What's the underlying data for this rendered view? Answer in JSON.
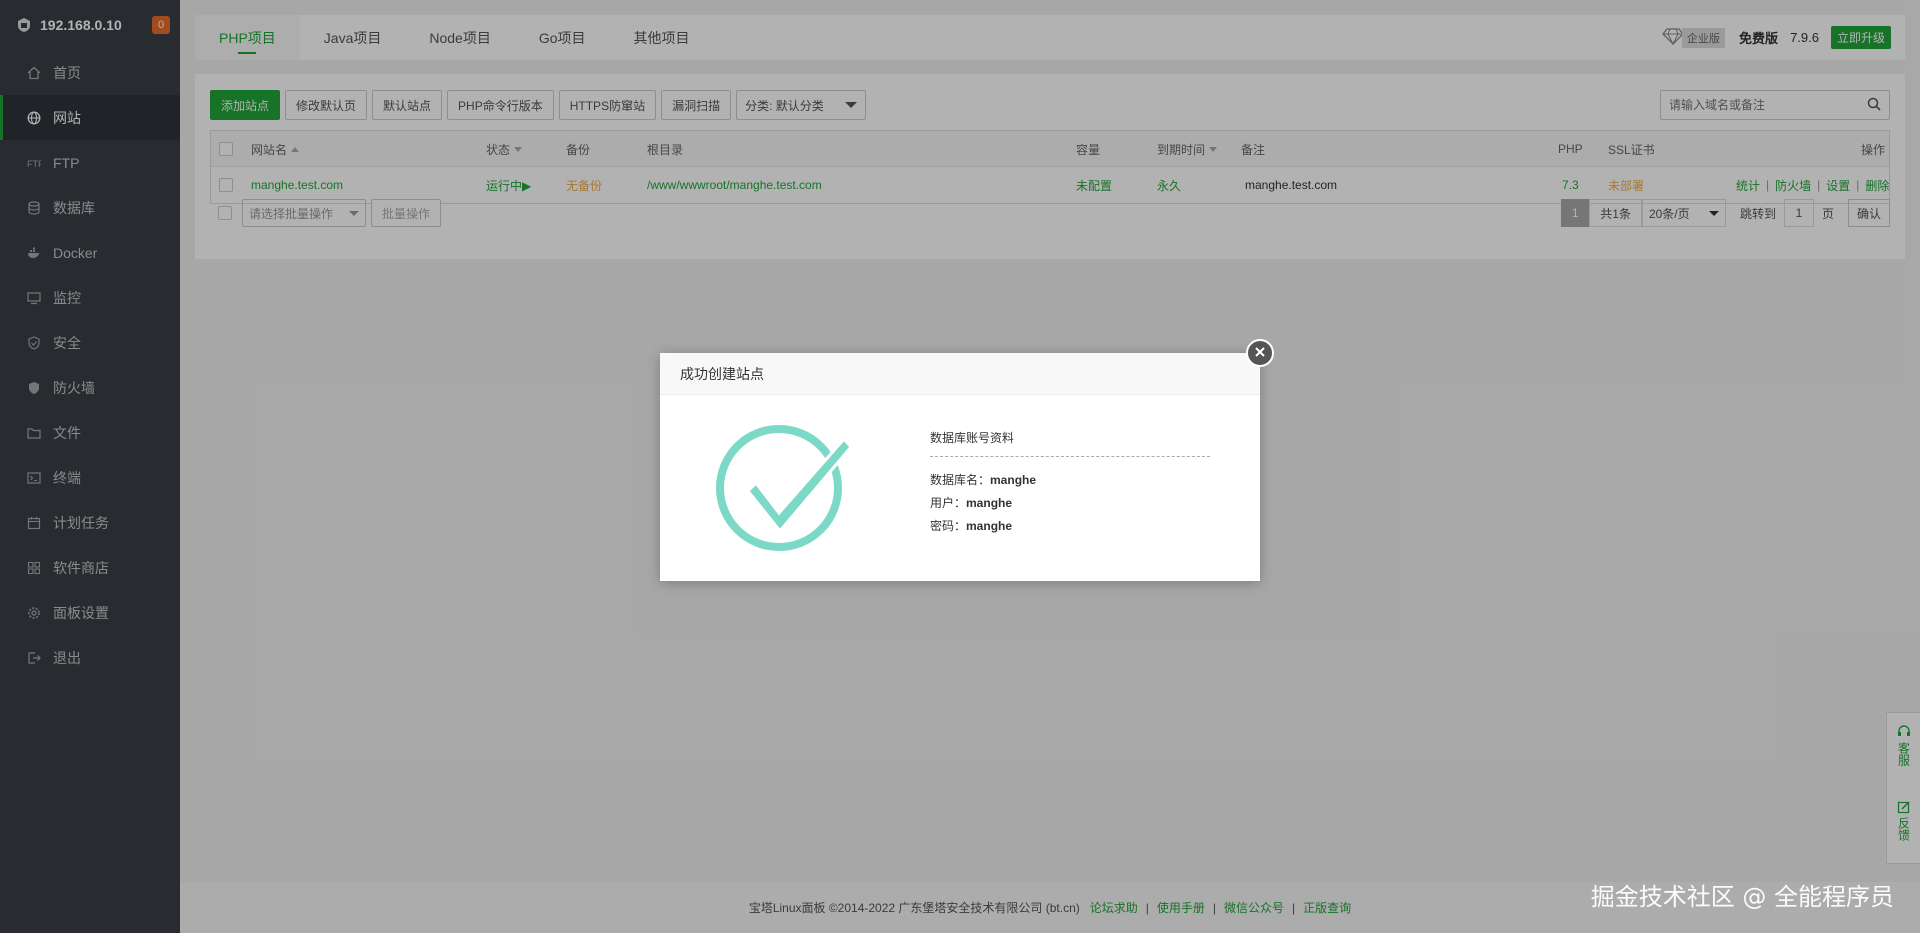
{
  "sidebar": {
    "server_ip": "192.168.0.10",
    "notification_count": "0",
    "items": [
      {
        "label": "首页",
        "icon": "home-icon"
      },
      {
        "label": "网站",
        "icon": "globe-icon",
        "active": true
      },
      {
        "label": "FTP",
        "icon": "ftp-icon"
      },
      {
        "label": "数据库",
        "icon": "database-icon"
      },
      {
        "label": "Docker",
        "icon": "docker-icon"
      },
      {
        "label": "监控",
        "icon": "monitor-icon"
      },
      {
        "label": "安全",
        "icon": "shield-check-icon"
      },
      {
        "label": "防火墙",
        "icon": "shield-icon"
      },
      {
        "label": "文件",
        "icon": "folder-icon"
      },
      {
        "label": "终端",
        "icon": "terminal-icon"
      },
      {
        "label": "计划任务",
        "icon": "calendar-icon"
      },
      {
        "label": "软件商店",
        "icon": "apps-icon"
      },
      {
        "label": "面板设置",
        "icon": "gear-icon"
      },
      {
        "label": "退出",
        "icon": "logout-icon"
      }
    ]
  },
  "topbar": {
    "tabs": [
      "PHP项目",
      "Java项目",
      "Node项目",
      "Go项目",
      "其他项目"
    ],
    "enterprise_label": "企业版",
    "free_label": "免费版",
    "version": "7.9.6",
    "upgrade_label": "立即升级"
  },
  "toolbar": {
    "add_site": "添加站点",
    "edit_default_page": "修改默认页",
    "default_site": "默认站点",
    "php_cli_version": "PHP命令行版本",
    "https_guard": "HTTPS防窜站",
    "vuln_scan": "漏洞扫描",
    "category_select": "分类: 默认分类",
    "search_placeholder": "请输入域名或备注"
  },
  "table": {
    "headers": {
      "name": "网站名",
      "status": "状态",
      "backup": "备份",
      "root": "根目录",
      "quota": "容量",
      "expire": "到期时间",
      "remark": "备注",
      "php": "PHP",
      "ssl": "SSL证书",
      "action": "操作"
    },
    "rows": [
      {
        "name": "manghe.test.com",
        "status": "运行中▶",
        "backup": "无备份",
        "root": "/www/wwwroot/manghe.test.com",
        "quota": "未配置",
        "expire": "永久",
        "remark": "manghe.test.com",
        "php": "7.3",
        "ssl": "未部署",
        "actions": [
          "统计",
          "防火墙",
          "设置",
          "删除"
        ]
      }
    ]
  },
  "bottom": {
    "bulk_placeholder": "请选择批量操作",
    "bulk_button": "批量操作",
    "page_current": "1",
    "page_total": "共1条",
    "page_size": "20条/页",
    "jump_label": "跳转到",
    "jump_value": "1",
    "page_unit": "页",
    "confirm": "确认"
  },
  "footer": {
    "copyright": "宝塔Linux面板 ©2014-2022 广东堡塔安全技术有限公司 (bt.cn)",
    "links": [
      "论坛求助",
      "使用手册",
      "微信公众号",
      "正版查询"
    ]
  },
  "float_panel": {
    "service": "客服",
    "feedback": "反馈"
  },
  "watermark": "掘金技术社区 @ 全能程序员",
  "modal": {
    "title": "成功创建站点",
    "info_title": "数据库账号资料",
    "db_name_label": "数据库名：",
    "db_name": "manghe",
    "user_label": "用户：",
    "user": "manghe",
    "password_label": "密码：",
    "password": "manghe"
  },
  "colors": {
    "brand_green": "#20a53a",
    "sidebar_bg": "#3a3f47",
    "warning_orange": "#f0ad4e",
    "check_teal": "#7dd9c7"
  }
}
